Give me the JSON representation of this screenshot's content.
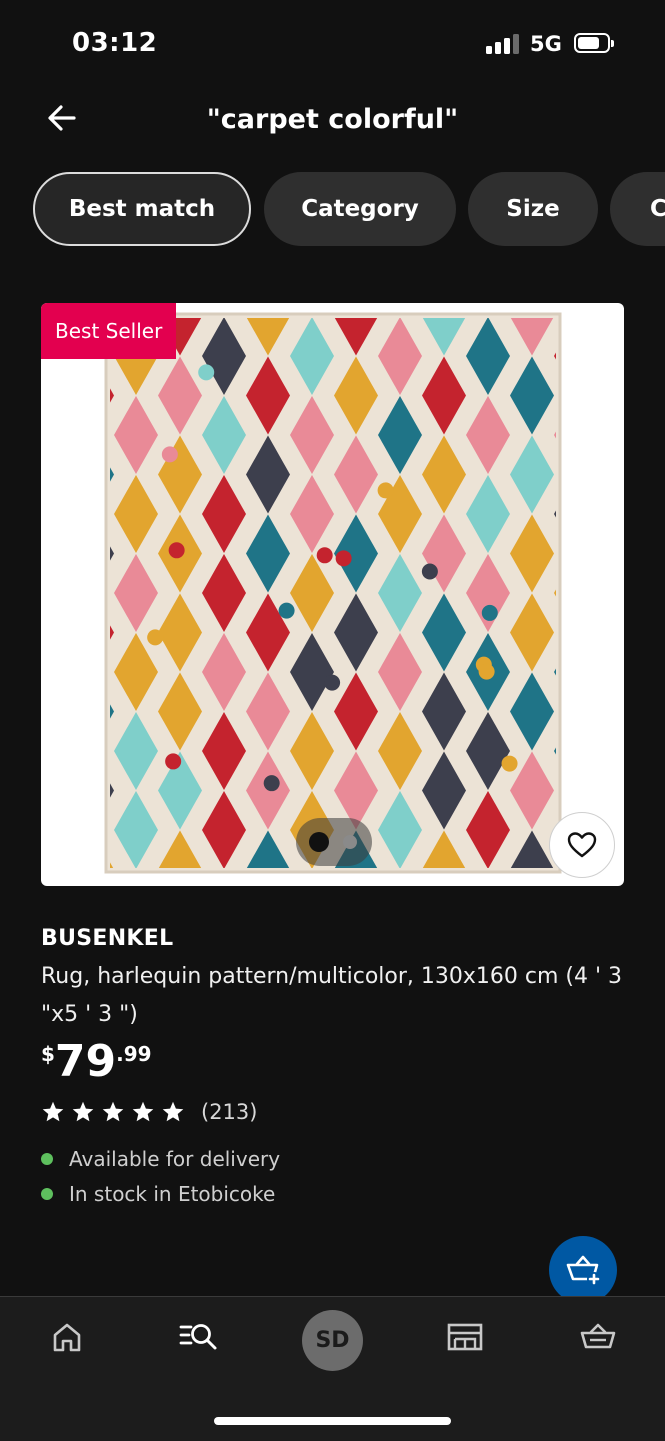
{
  "status_bar": {
    "time": "03:12",
    "network": "5G"
  },
  "header": {
    "title": "\"carpet colorful\""
  },
  "filters": [
    {
      "label": "Best match",
      "active": true
    },
    {
      "label": "Category",
      "active": false
    },
    {
      "label": "Size",
      "active": false
    },
    {
      "label": "C",
      "active": false
    }
  ],
  "product": {
    "badge": "Best Seller",
    "brand": "BUSENKEL",
    "description": "Rug, harlequin pattern/multicolor, 130x160 cm (4 ' 3 \"x5 ' 3 \")",
    "price": {
      "currency": "$",
      "integer": "79",
      "decimal": ".99"
    },
    "rating": {
      "stars": 5,
      "count": "(213)"
    },
    "availability": [
      {
        "text": "Available for delivery",
        "status_color": "#5ec05e"
      },
      {
        "text": "In stock in Etobicoke",
        "status_color": "#5ec05e"
      }
    ],
    "image_carousel": {
      "total": 2,
      "current": 1
    }
  },
  "bottom_nav": {
    "items": [
      {
        "icon": "home-icon"
      },
      {
        "icon": "search-list-icon"
      },
      {
        "icon": "avatar",
        "initials": "SD"
      },
      {
        "icon": "store-icon"
      },
      {
        "icon": "basket-icon"
      }
    ]
  },
  "colors": {
    "accent": "#0058a3",
    "badge": "#e3004f",
    "in_stock": "#5ec05e",
    "background": "#111111"
  }
}
